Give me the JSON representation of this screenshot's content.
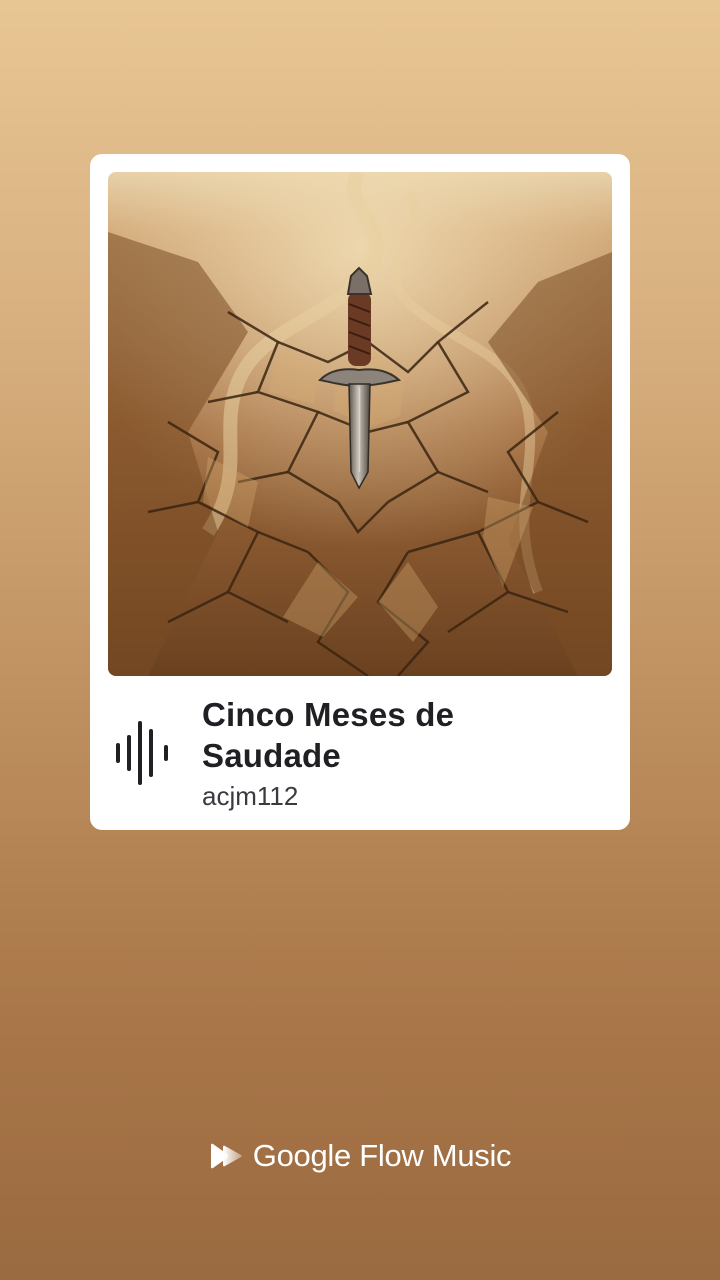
{
  "track": {
    "title": "Cinco Meses de Saudade",
    "artist": "acjm112",
    "artwork_icon": "cover-art-sword-in-cracked-earth"
  },
  "player": {
    "indicator_icon": "audio-waveform-icon"
  },
  "brand": {
    "name": "Google Flow Music",
    "logo_icon": "flow-music-logo-icon"
  },
  "colors": {
    "background_top": "#e8c694",
    "background_bottom": "#9a6a40",
    "card": "#ffffff",
    "title_text": "#1f1f24",
    "artist_text": "#3a3a40"
  }
}
